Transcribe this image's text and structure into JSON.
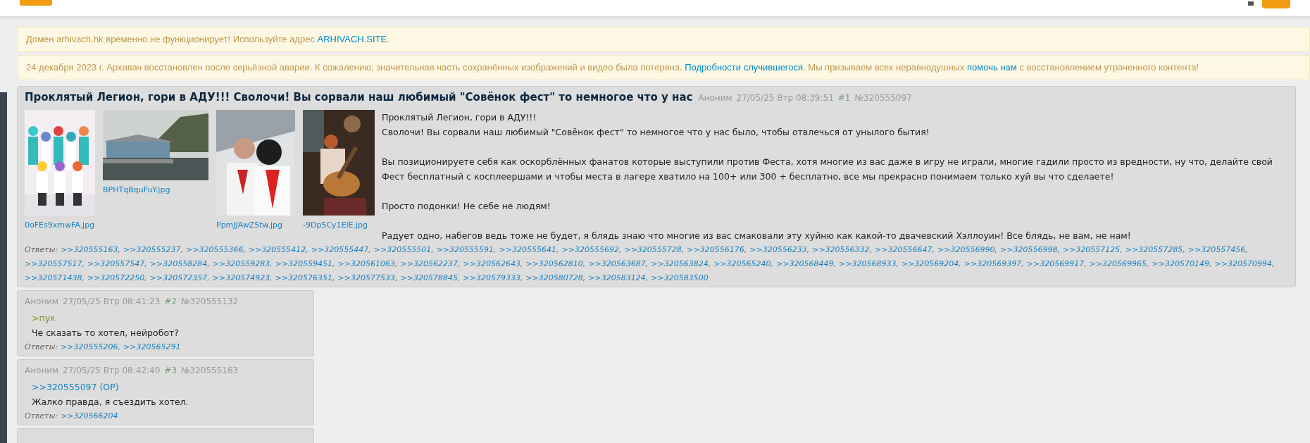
{
  "notices": [
    {
      "segments": [
        {
          "kind": "text",
          "text": "Домен arhivach.hk временно не функционирует! Используйте адрес "
        },
        {
          "kind": "link",
          "text": "ARHIVACH.SITE"
        },
        {
          "kind": "text",
          "text": "."
        }
      ]
    },
    {
      "segments": [
        {
          "kind": "text",
          "text": "24 декабря 2023 г. Архивач восстановлен после серьёзной аварии. К сожалению, значительная часть сохранённых изображений и видео была потеряна. "
        },
        {
          "kind": "link",
          "text": "Подробности случившегося"
        },
        {
          "kind": "text",
          "text": ". Мы призываем всех неравнодушных "
        },
        {
          "kind": "link",
          "text": "помочь нам"
        },
        {
          "kind": "text",
          "text": " с восстановлением утраченного контента!"
        }
      ]
    }
  ],
  "op": {
    "title": "Проклятый Легион, гори в АДУ!!! Сволочи! Вы сорвали наш любимый \"Совёнок фест\" то немногое что у нас",
    "author": "Аноним",
    "date": "27/05/25 Втр 08:39:51",
    "num": "#1",
    "id": "№320555097",
    "images": [
      {
        "filename": "0oFEs9xmwFA.jpg",
        "kind": "group"
      },
      {
        "filename": "BPHTqBquFuY.jpg",
        "kind": "house"
      },
      {
        "filename": "PpmJJAwZ5tw.jpg",
        "kind": "pair"
      },
      {
        "filename": "-9Dp5Cy1ElE.jpg",
        "kind": "guitar"
      }
    ],
    "paragraphs": [
      [
        "Проклятый Легион, гори в АДУ!!!",
        "Сволочи! Вы сорвали наш любимый \"Совёнок фест\" то немногое что у нас было, чтобы отвлечься от унылого бытия!"
      ],
      [
        "Вы позиционируете себя как оскорблённых фанатов которые выступили против Феста, хотя многие из вас даже в игру не играли, многие гадили просто из вредности, ну что, делайте свой Фест бесплатный с косплеершами и чтобы места в лагере хватило на 100+ или 300 + бесплатно, все мы прекрасно понимаем только хуй вы что сделаете!"
      ],
      [
        "Просто подонки! Не себе не людям!"
      ],
      [
        "Радует одно, набегов ведь тоже не будет, я блядь знаю что многие из вас смаковали эту хуйню как какой-то двачевский Хэллоуин! Все блядь, не вам, не нам!"
      ]
    ],
    "replies_label": "Ответы:",
    "replies_separator": ",",
    "replies": [
      ">>320555163",
      ">>320555237",
      ">>320555366",
      ">>320555412",
      ">>320555447",
      ">>320555501",
      ">>320555591",
      ">>320555641",
      ">>320555692",
      ">>320555728",
      ">>320556176",
      ">>320556233",
      ">>320556332",
      ">>320556647",
      ">>320556990",
      ">>320556998",
      ">>320557125",
      ">>320557285",
      ">>320557456",
      ">>320557517",
      ">>320557547",
      ">>320558284",
      ">>320559283",
      ">>320559451",
      ">>320561063",
      ">>320562237",
      ">>320562643",
      ">>320562810",
      ">>320563687",
      ">>320563824",
      ">>320565240",
      ">>320568449",
      ">>320568933",
      ">>320569204",
      ">>320569397",
      ">>320569917",
      ">>320569965",
      ">>320570149",
      ">>320570994",
      ">>320571438",
      ">>320572250",
      ">>320572357",
      ">>320574923",
      ">>320576351",
      ">>320577533",
      ">>320578845",
      ">>320579333",
      ">>320580728",
      ">>320583124",
      ">>320583500"
    ]
  },
  "posts": [
    {
      "author": "Аноним",
      "date": "27/05/25 Втр 08:41:23",
      "num": "#2",
      "id": "№320555132",
      "lines": [
        {
          "kind": "quote",
          "text": ">пук"
        },
        {
          "kind": "text",
          "text": "Че сказать то хотел, нейробот?"
        }
      ],
      "replies_label": "Ответы:",
      "replies_separator": ",",
      "replies": [
        ">>320555206",
        ">>320565291"
      ]
    },
    {
      "author": "Аноним",
      "date": "27/05/25 Втр 08:42:40",
      "num": "#3",
      "id": "№320555163",
      "lines": [
        {
          "kind": "reply",
          "text": ">>320555097 (OP)"
        },
        {
          "kind": "text",
          "text": "Жалко правда, я съездить хотел."
        }
      ],
      "replies_label": "Ответы:",
      "replies": [
        ">>320566204"
      ]
    }
  ]
}
